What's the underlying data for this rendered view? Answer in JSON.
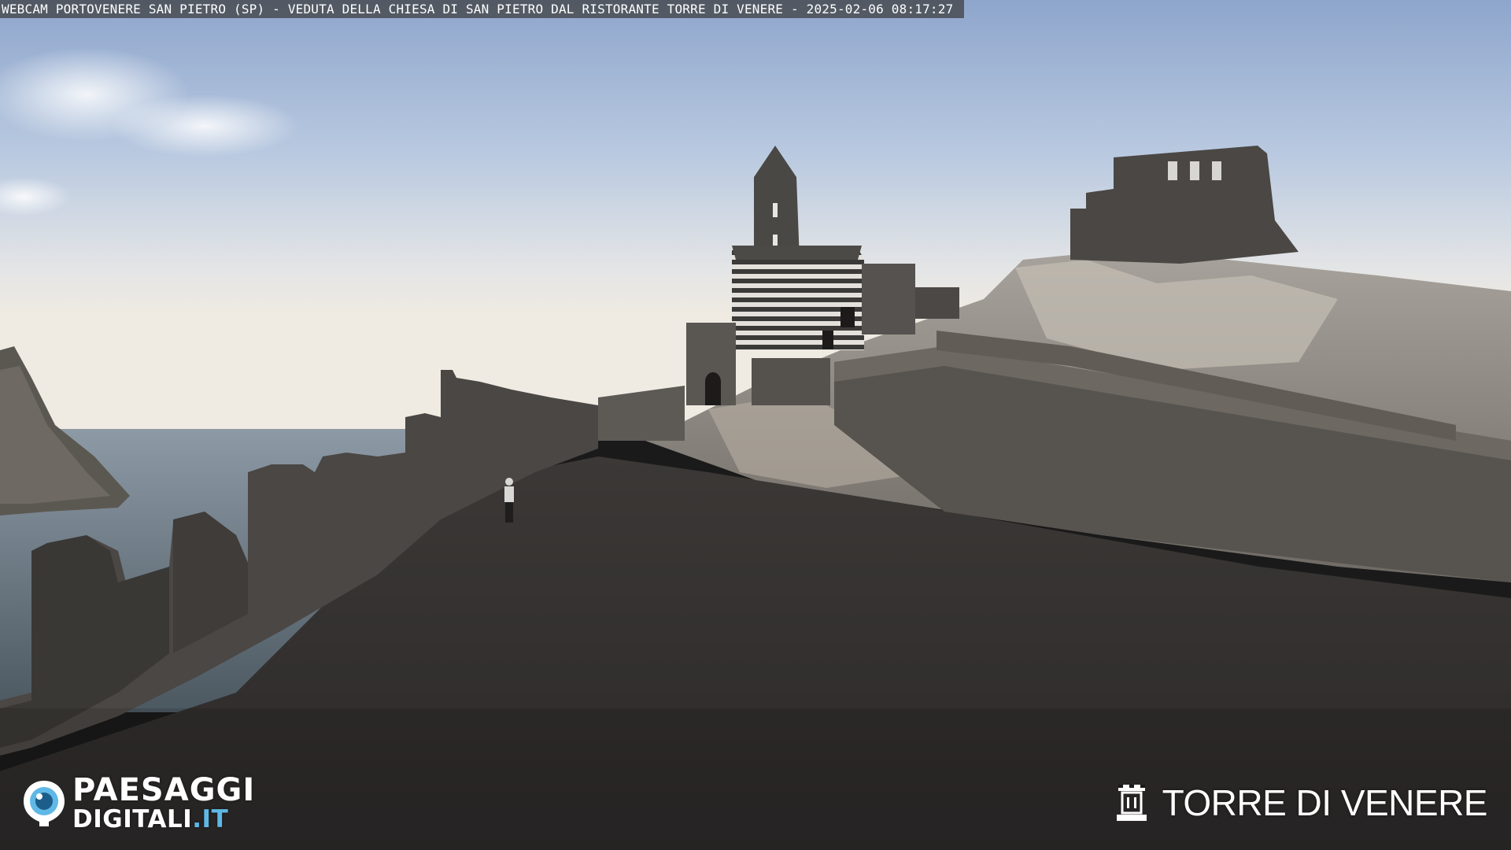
{
  "overlay": {
    "caption": "WEBCAM PORTOVENERE SAN PIETRO (SP) - VEDUTA DELLA CHIESA DI SAN PIETRO DAL RISTORANTE TORRE DI VENERE - 2025-02-06 08:17:27"
  },
  "logos": {
    "left": {
      "line1": "PAESAGGI",
      "line2": "DIGITALI",
      "line2_suffix": ".IT",
      "icon": "eye-icon",
      "accent": "#5fb8e6"
    },
    "right": {
      "name": "TORRE DI VENERE",
      "icon": "tower-icon"
    }
  }
}
